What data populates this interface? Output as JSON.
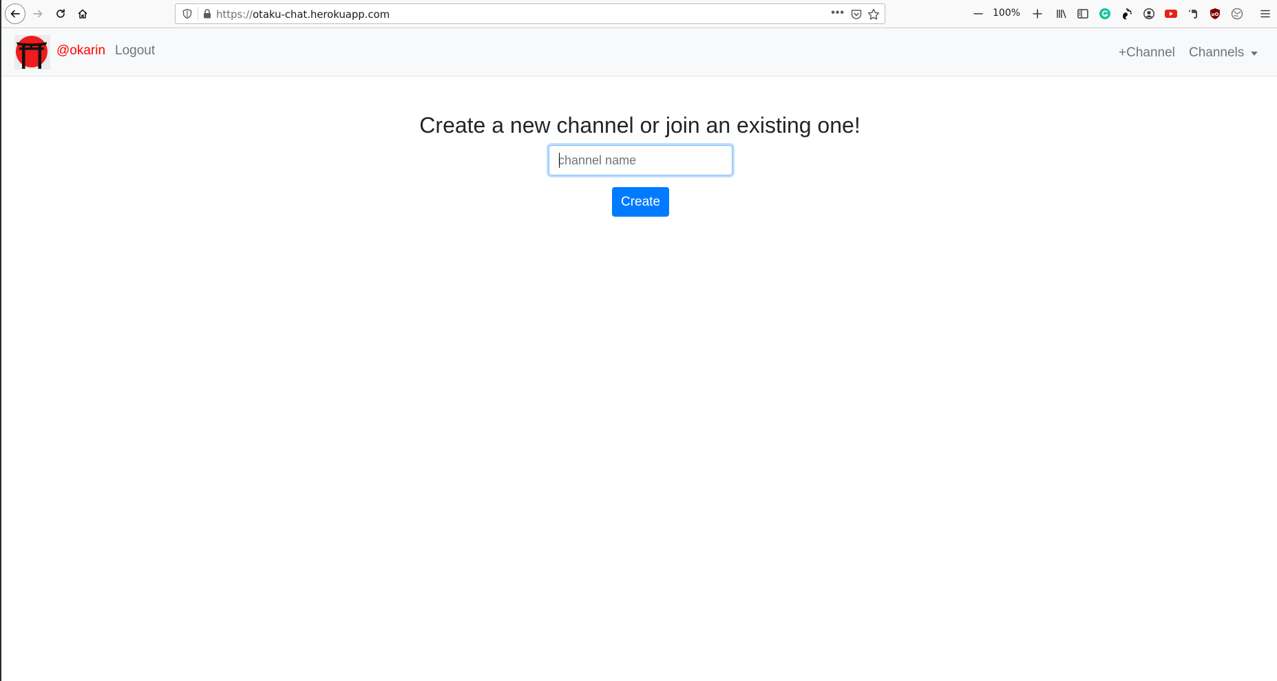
{
  "browser": {
    "url_protocol": "https://",
    "url_host": "otaku-chat.herokuapp.com",
    "zoom_level": "100%",
    "icons": [
      "back-icon",
      "forward-icon",
      "reload-icon",
      "home-icon",
      "shield-icon",
      "lock-icon",
      "more-icon",
      "pocket-icon",
      "bookmark-star-icon",
      "zoom-out-icon",
      "zoom-in-icon",
      "library-icon",
      "sidebar-icon",
      "grammarly-icon",
      "gnome-icon",
      "account-icon",
      "youtube-icon",
      "evernote-icon",
      "ublock-icon",
      "extension-icon",
      "menu-icon"
    ]
  },
  "navbar": {
    "username": "@okarin",
    "logout_label": "Logout",
    "add_channel_label": "+Channel",
    "channels_label": "Channels"
  },
  "main": {
    "title": "Create a new channel or join an existing one!",
    "input_placeholder": "channel name",
    "create_label": "Create"
  },
  "colors": {
    "brand_red": "#ff0000",
    "primary_blue": "#007bff",
    "navbar_bg": "#f8f9fa",
    "muted_text": "#6c757d"
  }
}
